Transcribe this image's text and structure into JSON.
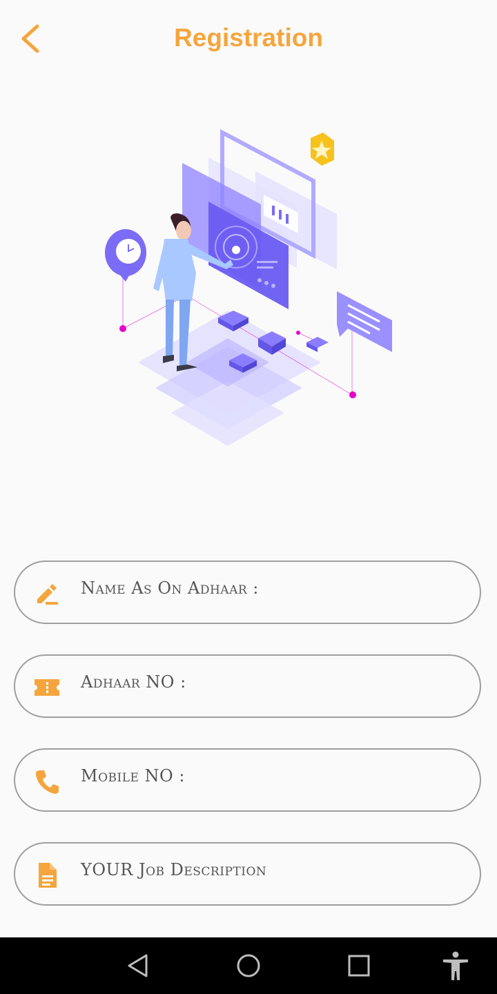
{
  "header": {
    "title": "Registration"
  },
  "form": {
    "fields": [
      {
        "label": "Name As On Adhaar :",
        "icon": "edit-icon"
      },
      {
        "label": "Adhaar NO :",
        "icon": "id-card-icon"
      },
      {
        "label": "Mobile NO :",
        "icon": "phone-icon"
      },
      {
        "label": "YOUR Job Description",
        "icon": "document-icon"
      }
    ]
  },
  "colors": {
    "accent": "#f5a53d",
    "border": "#9e9e9e",
    "illustration": "#7b6cf6",
    "connector": "#e600c8"
  },
  "nav": {
    "buttons": [
      "back-triangle-icon",
      "home-circle-icon",
      "recents-square-icon",
      "accessibility-icon"
    ]
  }
}
